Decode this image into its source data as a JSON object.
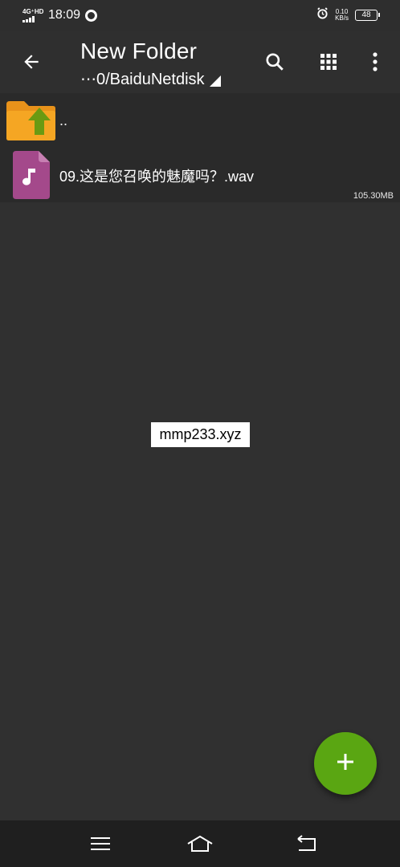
{
  "status_bar": {
    "network": "4G⁺HD",
    "time": "18:09",
    "speed_value": "0.10",
    "speed_unit": "KB/s",
    "battery": "48",
    "icons": [
      "signal-icon",
      "app-notification-icon",
      "alarm-icon",
      "battery-icon"
    ]
  },
  "app_bar": {
    "title": "New Folder",
    "path": "⋯0/BaiduNetdisk",
    "icons": [
      "back-arrow-icon",
      "search-icon",
      "grid-view-icon",
      "more-vert-icon"
    ]
  },
  "files": [
    {
      "name": "..",
      "icon": "folder-up-icon",
      "size": ""
    },
    {
      "name": "09.这是您召唤的魅魔吗？.wav",
      "icon": "audio-file-icon",
      "size": "105.30MB"
    }
  ],
  "watermark": "mmp233.xyz",
  "fab": {
    "icon": "plus-icon",
    "color": "#5aa612"
  },
  "nav_bar": {
    "icons": [
      "menu-icon",
      "home-icon",
      "back-icon"
    ]
  },
  "colors": {
    "background": "#303030",
    "list_background": "#2a2a2a",
    "folder_orange": "#f5a623",
    "arrow_green": "#6a9a12",
    "audio_purple": "#a4498b"
  }
}
